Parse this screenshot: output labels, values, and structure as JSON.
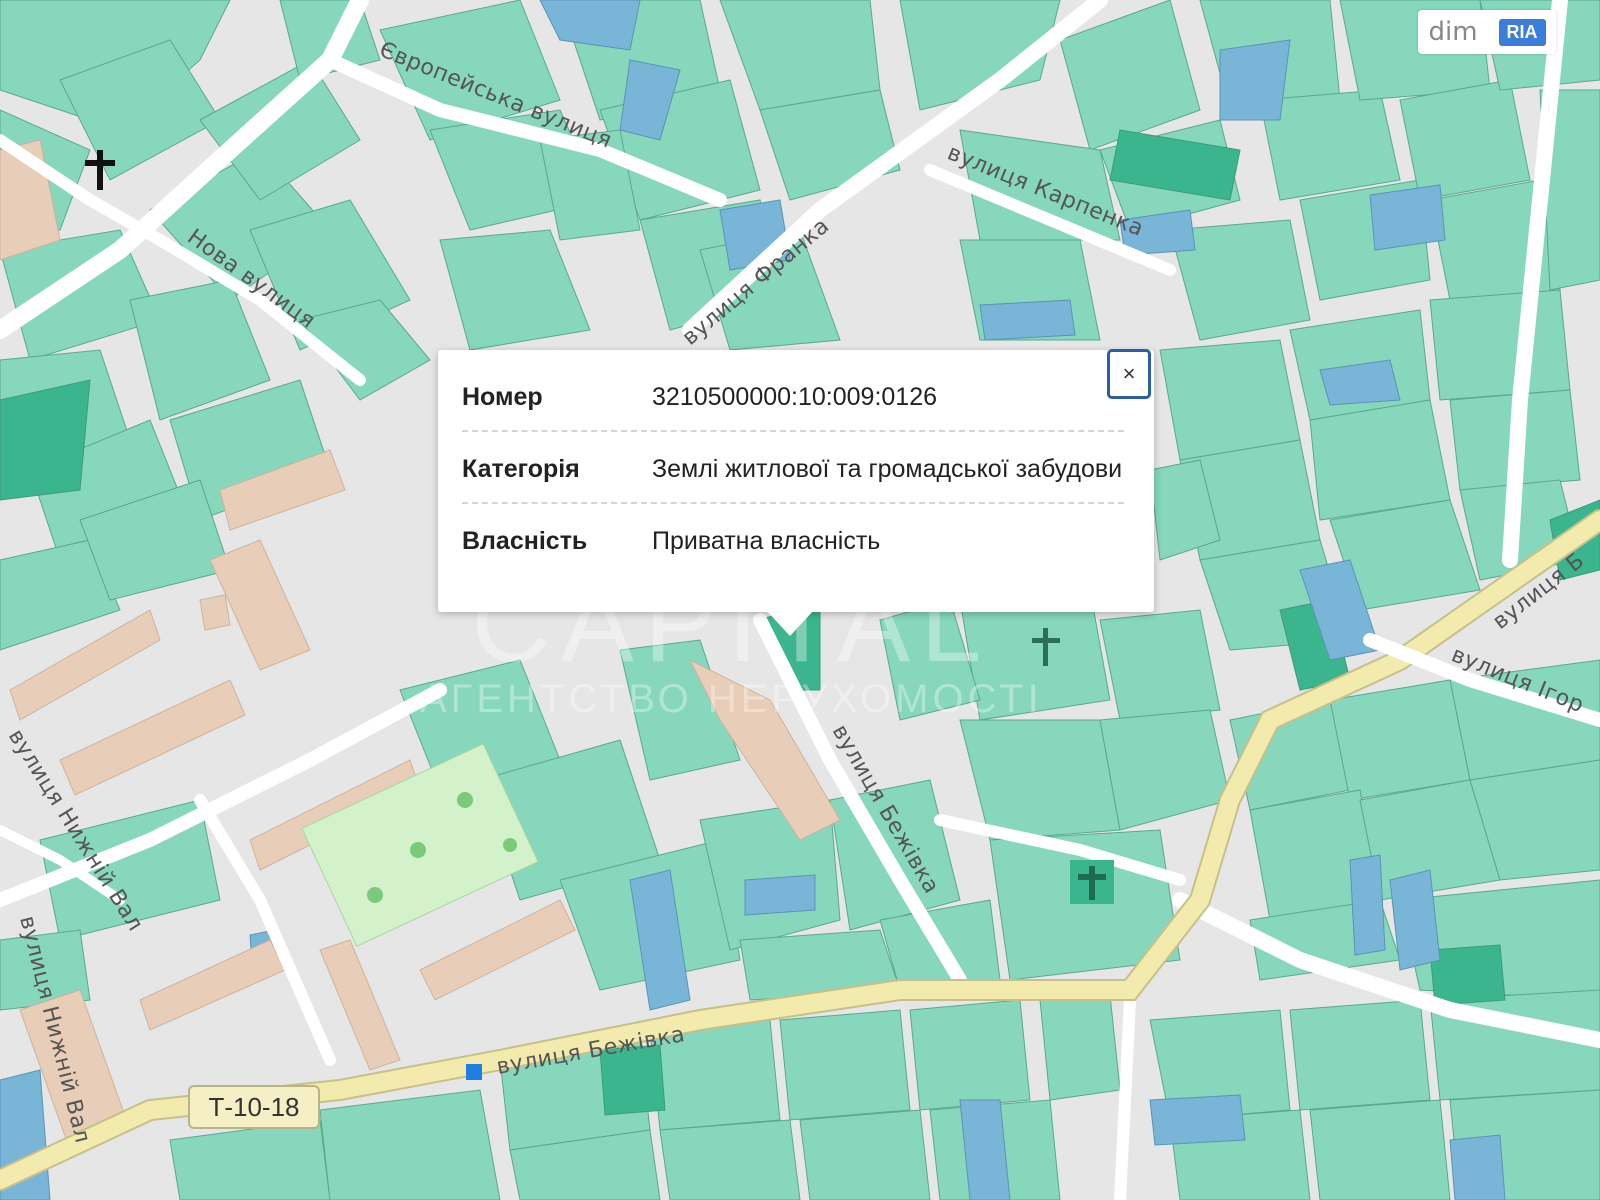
{
  "map": {
    "streets": {
      "evropeiska": "Європейська вулиця",
      "nova": "Нова вулиця",
      "franka": "вулиця Франка",
      "karpenka": "вулиця Карпенка",
      "bezhivka_side": "вулиця Бежівка",
      "bezhivka_main": "вулиця Бежівка",
      "nyzhnii_val_1": "вулиця Нижній Вал",
      "nyzhnii_val_2": "вулиця Нижній Вал",
      "igor_east": "вулиця Ігор",
      "street_b_east": "вулиця Б"
    },
    "road_badge": "Т-10-18",
    "colors": {
      "parcel": "#86d7bb",
      "parcel_dark": "#3bb58e",
      "parcel_blue": "#78b5d6",
      "road_main": "#f2ebad",
      "background": "#e6e6e6",
      "building": "#e8cdb8",
      "park": "#d3f2cc"
    },
    "icons": [
      "church-icon",
      "church-icon",
      "church-icon",
      "dog-park-icon",
      "bus-stop-icon"
    ]
  },
  "popup": {
    "rows": [
      {
        "key": "Номер",
        "value": "3210500000:10:009:0126"
      },
      {
        "key": "Категорія",
        "value": "Землі житлової та громадської забудови"
      },
      {
        "key": "Власність",
        "value": "Приватна власність"
      }
    ],
    "close_label": "×"
  },
  "logo": {
    "left": "dim",
    "right": "RIA"
  },
  "watermark": {
    "line1": "CAPITAL",
    "line2": "АГЕНТСТВО НЕРУХОМОСТІ"
  }
}
